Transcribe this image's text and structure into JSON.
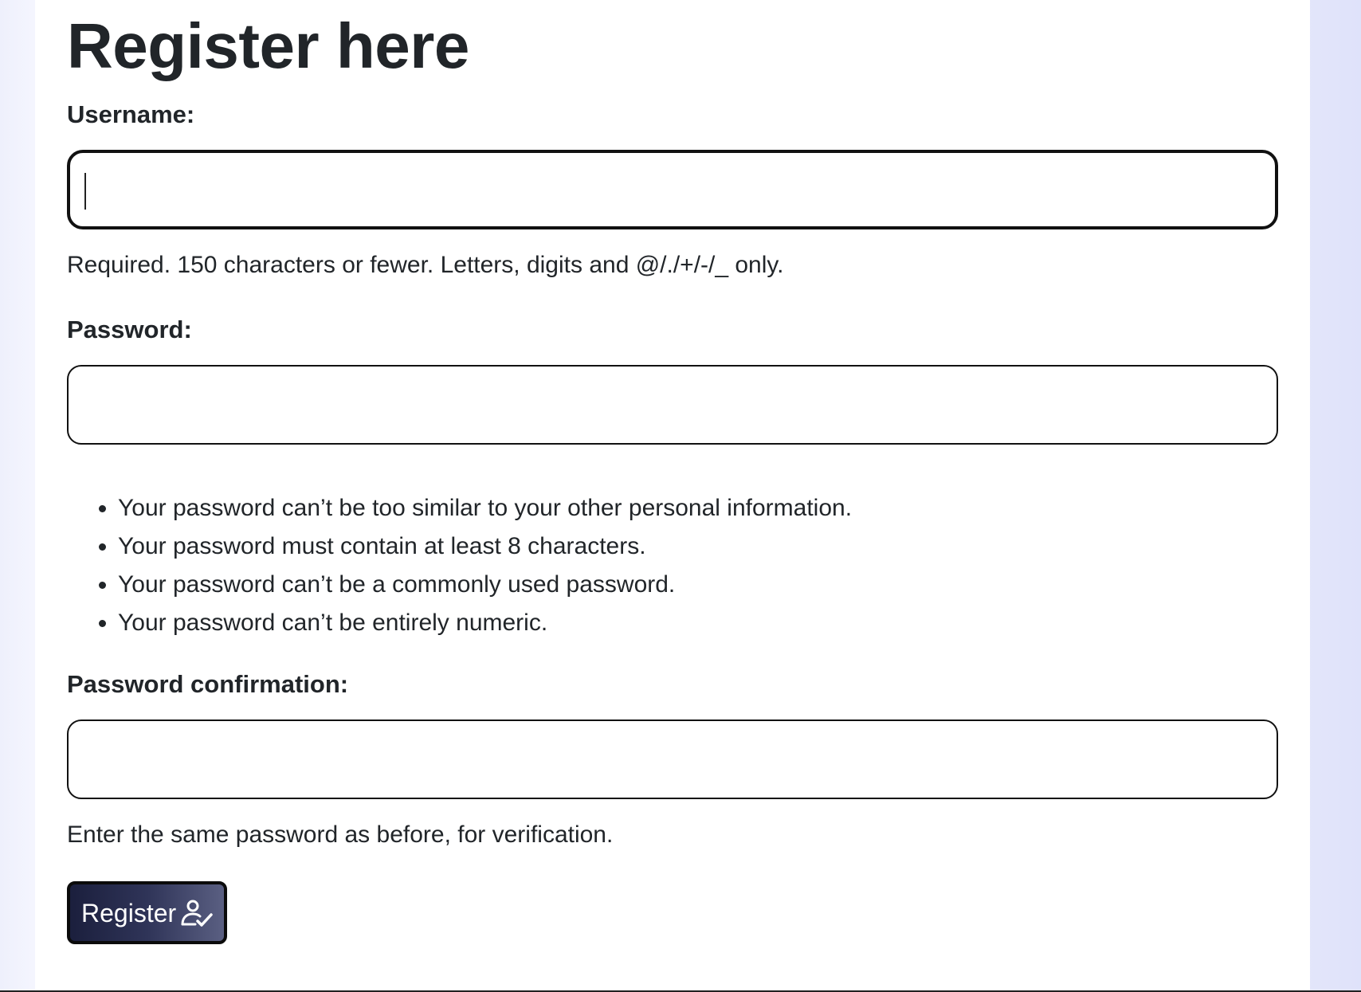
{
  "page_title": "Register here",
  "form": {
    "username": {
      "label": "Username:",
      "value": "",
      "help": "Required. 150 characters or fewer. Letters, digits and @/./+/-/_ only."
    },
    "password": {
      "label": "Password:",
      "value": "",
      "rules": [
        "Your password can’t be too similar to your other personal information.",
        "Your password must contain at least 8 characters.",
        "Your password can’t be a commonly used password.",
        "Your password can’t be entirely numeric."
      ]
    },
    "password_confirmation": {
      "label": "Password confirmation:",
      "value": "",
      "help": "Enter the same password as before, for verification."
    },
    "submit": {
      "label": "Register",
      "icon": "person-check-icon"
    }
  }
}
